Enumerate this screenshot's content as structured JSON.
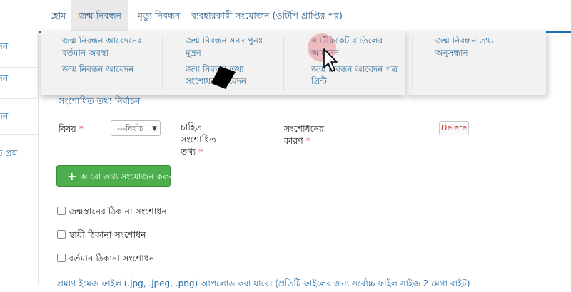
{
  "nav": {
    "items": [
      {
        "label": "হোম"
      },
      {
        "label": "জন্ম নিবন্ধন"
      },
      {
        "label": "মৃত্যু নিবন্ধন"
      },
      {
        "label": "ব্যবহারকারী সংযোজন (ওটিপি প্রাপ্তির পর)"
      }
    ],
    "active_index": 1
  },
  "sidebar": {
    "items": [
      {
        "label": "ন্ধন"
      },
      {
        "label": "ন্ধন"
      },
      {
        "label": "ন্ধন"
      },
      {
        "label": "ত প্রশ্ন"
      }
    ]
  },
  "dropdown": {
    "items": [
      {
        "label": "জন্ম নিবন্ধন আবেদনের বর্তমান অবস্থা"
      },
      {
        "label": "জন্ম নিবন্ধন সনদ পুনঃ মুদ্রন"
      },
      {
        "label": "সার্টিফিকেট বাতিলের আবেদন"
      },
      {
        "label": "জন্ম নিবন্ধন তথ্য অনুসন্ধান"
      },
      {
        "label": "জন্ম নিবন্ধন আবেদন"
      },
      {
        "label": "জন্ম নিবন্ধন তথ্য সংশোধন আবেদন"
      },
      {
        "label": "জন্ম নিবন্ধন আবেদন পত্র প্রিন্ট"
      }
    ]
  },
  "form": {
    "section_title": "সংশোধিত তথ্য নির্বাচন",
    "subject_label": "বিষয়",
    "required_mark": "*",
    "select_value": "---নির্বাচ",
    "desired_info_label": "চাহিত সংশোধিত তথ্য",
    "reason_label": "সংশোধনের কারণ",
    "delete_label": "Delete",
    "add_more_label": "আরো তথ্য সংযোজন করুন",
    "checkboxes": [
      {
        "label": "জন্মস্থানের ঠিকানা সংশোধন",
        "checked": false
      },
      {
        "label": "স্থায়ী ঠিকানা সংশোধন",
        "checked": false
      },
      {
        "label": "বর্তমান ঠিকানা সংশোধন",
        "checked": false
      }
    ],
    "bottom_note": "প্রমাণ ইমেজ ফাইল (.jpg, .jpeg, .png) আপলোড করা যাবে। (প্রতিটি ফাইলের জন্য সর্বোচ্চ ফাইল সাইজ 2 মেগা বাইট)"
  },
  "colors": {
    "link_blue": "#2a6da6",
    "button_green": "#4cae4c",
    "accent_rule": "#1f6fb4",
    "halo": "#e65a64"
  }
}
